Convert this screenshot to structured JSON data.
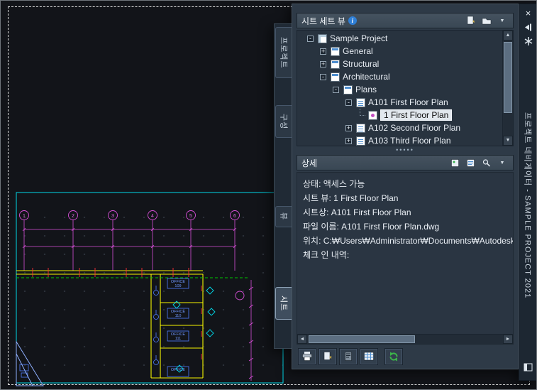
{
  "window": {
    "title_vertical": "프로젝트 네비게이터 - SAMPLE PROJECT 2021"
  },
  "tabs": [
    {
      "label": "프로젝트",
      "active": false
    },
    {
      "label": "구성",
      "active": false
    },
    {
      "label": "뷰",
      "active": false
    },
    {
      "label": "시트",
      "active": true
    }
  ],
  "sheet_view_panel": {
    "header": "시트 세트 뷰",
    "tree": {
      "items": [
        {
          "label": "Sample Project",
          "level": 0,
          "expander": "-"
        },
        {
          "label": "General",
          "level": 1,
          "expander": "+"
        },
        {
          "label": "Structural",
          "level": 1,
          "expander": "+"
        },
        {
          "label": "Architectural",
          "level": 1,
          "expander": "-"
        },
        {
          "label": "Plans",
          "level": 2,
          "expander": "-"
        },
        {
          "label": "A101 First Floor Plan",
          "level": 3,
          "expander": "-"
        },
        {
          "label": "1 First Floor Plan",
          "level": 4,
          "expander": "",
          "selected": true
        },
        {
          "label": "A102 Second Floor Plan",
          "level": 3,
          "expander": "+"
        },
        {
          "label": "A103 Third Floor Plan",
          "level": 3,
          "expander": "+"
        }
      ]
    }
  },
  "details_panel": {
    "header": "상세",
    "lines": [
      "상태: 액세스 가능",
      "시트 뷰: 1 First Floor Plan",
      "",
      "시트상: A101 First Floor Plan",
      "파일 이름: A101 First Floor Plan.dwg",
      "위치: C:₩Users₩Administrator₩Documents₩Autodesk₩",
      "체크 인 내역:"
    ]
  },
  "icons": {
    "info": "i",
    "close": "×",
    "chevron_down": "▼",
    "scroll_up": "▲",
    "scroll_down": "▼",
    "scroll_left": "◄",
    "scroll_right": "►",
    "splitter_dots": "•••••",
    "new_sheet_star": "*"
  },
  "drawing": {
    "grid_bubbles": [
      "1",
      "2",
      "3",
      "4",
      "5",
      "6"
    ],
    "rooms": [
      {
        "name": "OFFICE",
        "number": "109"
      },
      {
        "name": "OFFICE",
        "number": "110"
      },
      {
        "name": "OFFICE",
        "number": "111"
      },
      {
        "name": "OFFICE",
        "number": ""
      }
    ],
    "colors": {
      "viewport_border": "#00d8e8",
      "dimensions": "#d84fd8",
      "walls": "#f5f500",
      "openings": "#ff3535",
      "hidden_lines": "#00c800",
      "annotation": "#4f7dff",
      "paper_border": "#dcdcdc",
      "palette_bg": "#2e3a47"
    }
  }
}
